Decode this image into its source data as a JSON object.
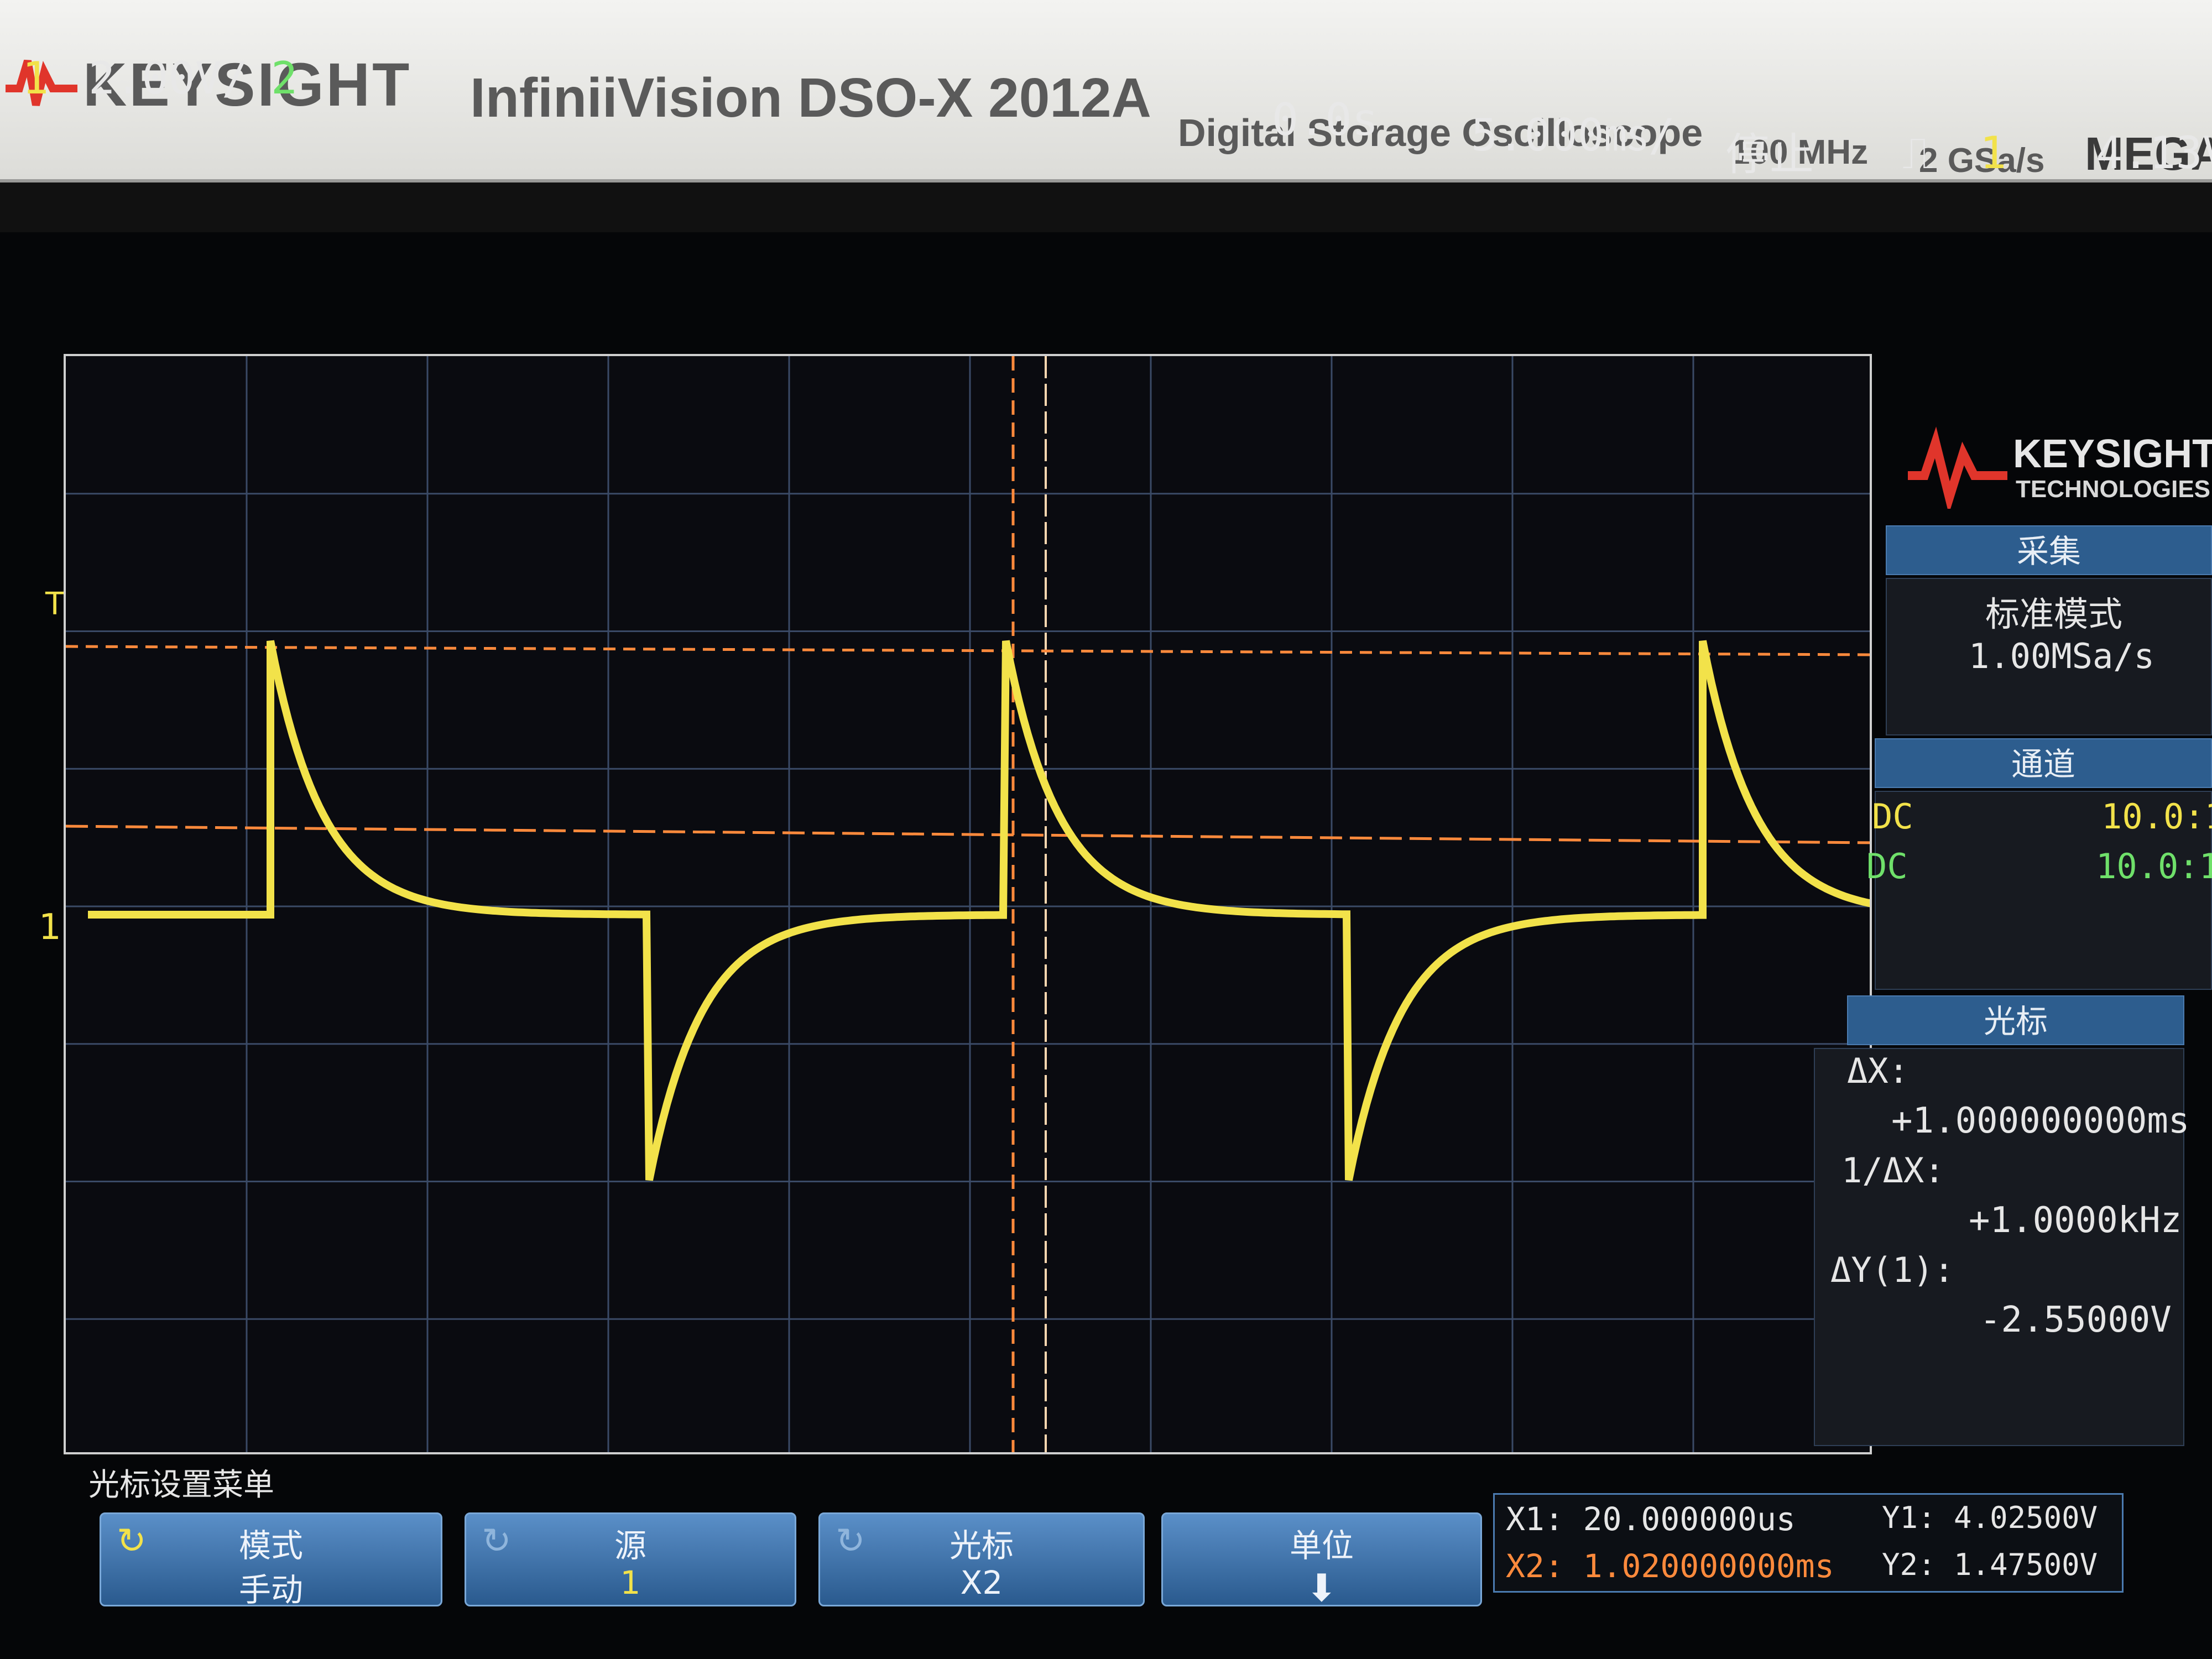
{
  "bezel": {
    "brand": "KEYSIGHT",
    "model": "InfiniiVision DSO-X 2012A",
    "description": "Digital Storage Oscilloscope",
    "bandwidth": "100 MHz",
    "sample_rate": "2 GSa/s",
    "badge": "MEGA"
  },
  "header": {
    "ch1_num": "1",
    "ch1_scale": "2.00V/",
    "ch2_num": "2",
    "time_delay": "0.0s",
    "time_scale": "5.000㎳/",
    "run_status": "停止",
    "trigger_icon": "rising-edge-icon",
    "trigger_source": "1",
    "trigger_level": "4.13V"
  },
  "markers": {
    "ground": "1",
    "trigger": "T"
  },
  "side_panel": {
    "logo_word": "KEYSIGHT",
    "logo_sub": "TECHNOLOGIES",
    "acquire": {
      "title": "采集",
      "mode": "标准模式",
      "rate": "1.00MSa/s"
    },
    "channels": {
      "title": "通道",
      "rows": [
        {
          "coupling": "DC",
          "probe": "10.0:1"
        },
        {
          "coupling": "DC",
          "probe": "10.0:1"
        }
      ]
    },
    "cursors": {
      "title": "光标",
      "dx_label": "ΔX:",
      "dx_value": "+1.000000000ms",
      "inv_dx_label": "1/ΔX:",
      "inv_dx_value": "+1.0000kHz",
      "dy_label": "ΔY(1):",
      "dy_value": "-2.55000V"
    }
  },
  "menu": {
    "title": "光标设置菜单",
    "softkeys": [
      {
        "label": "模式",
        "value": "手动"
      },
      {
        "label": "源",
        "value": "1"
      },
      {
        "label": "光标",
        "value": "X2"
      },
      {
        "label": "单位",
        "value": ""
      }
    ]
  },
  "readout": {
    "x1": "X1: 20.000000us",
    "x2": "X2: 1.020000000ms",
    "y1": "Y1: 4.02500V",
    "y2": "Y2: 1.47500V"
  },
  "colors": {
    "ch1": "#f2e24a",
    "ch2": "#6fe06a",
    "cursor": "#ff8a3c",
    "menu": "#2d5d8e"
  }
}
